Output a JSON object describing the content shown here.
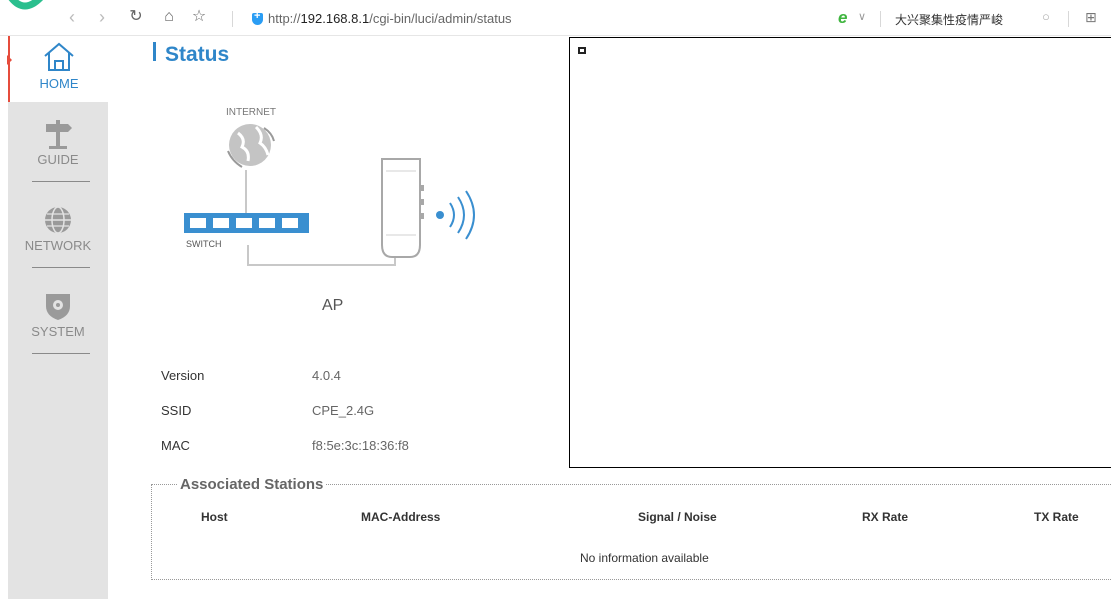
{
  "browser": {
    "url_prefix": "http://",
    "url_host": "192.168.8.1",
    "url_path": "/cgi-bin/luci/admin/status",
    "news_text": "大兴聚集性疫情严峻"
  },
  "sidebar": {
    "items": [
      {
        "label": "HOME",
        "icon": "home-icon"
      },
      {
        "label": "GUIDE",
        "icon": "signpost-icon"
      },
      {
        "label": "NETWORK",
        "icon": "globe-icon"
      },
      {
        "label": "SYSTEM",
        "icon": "shield-gear-icon"
      }
    ]
  },
  "page": {
    "title": "Status"
  },
  "diagram": {
    "internet_label": "INTERNET",
    "switch_label": "SWITCH",
    "ap_label": "AP"
  },
  "info": {
    "rows": [
      {
        "label": "Version",
        "value": "4.0.4"
      },
      {
        "label": "SSID",
        "value": "CPE_2.4G"
      },
      {
        "label": "MAC",
        "value": "f8:5e:3c:18:36:f8"
      }
    ]
  },
  "stations": {
    "legend": "Associated Stations",
    "columns": [
      "Host",
      "MAC-Address",
      "Signal / Noise",
      "RX Rate",
      "TX Rate"
    ],
    "empty_text": "No information available"
  },
  "colors": {
    "accent": "#2f86c9",
    "active_marker": "#e64c3c",
    "sidebar_bg": "#e3e3e3"
  }
}
